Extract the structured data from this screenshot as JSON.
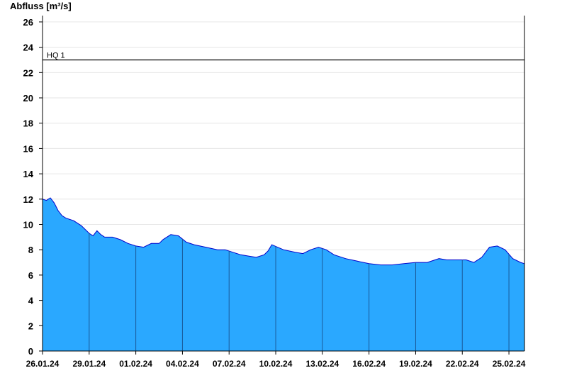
{
  "chart_data": {
    "type": "area",
    "ylabel": "Abfluss [m³/s]",
    "xlabel": "",
    "title": "",
    "ylim": [
      0,
      26.5
    ],
    "xlim": [
      "2024-01-26",
      "2024-02-26"
    ],
    "yticks": [
      0,
      2,
      4,
      6,
      8,
      10,
      12,
      14,
      16,
      18,
      20,
      22,
      24,
      26
    ],
    "xticks": [
      "26.01.24",
      "29.01.24",
      "01.02.24",
      "04.02.24",
      "07.02.24",
      "10.02.24",
      "13.02.24",
      "16.02.24",
      "19.02.24",
      "22.02.24",
      "25.02.24"
    ],
    "grid": true,
    "fill_color": "#2aa8ff",
    "line_color": "#0000cc",
    "reference_lines": [
      {
        "label": "HQ 1",
        "value": 23,
        "color": "#000000"
      }
    ],
    "series": [
      {
        "x": [
          "2024-01-26 00:00",
          "2024-01-26 06:00",
          "2024-01-26 12:00",
          "2024-01-26 18:00",
          "2024-01-27 00:00",
          "2024-01-27 06:00",
          "2024-01-27 12:00",
          "2024-01-28 00:00",
          "2024-01-28 12:00",
          "2024-01-29 00:00",
          "2024-01-29 06:00",
          "2024-01-29 12:00",
          "2024-01-29 18:00",
          "2024-01-30 00:00",
          "2024-01-30 12:00",
          "2024-01-31 00:00",
          "2024-01-31 12:00",
          "2024-02-01 00:00",
          "2024-02-01 12:00",
          "2024-02-02 00:00",
          "2024-02-02 12:00",
          "2024-02-02 18:00",
          "2024-02-03 06:00",
          "2024-02-03 18:00",
          "2024-02-04 06:00",
          "2024-02-04 18:00",
          "2024-02-05 12:00",
          "2024-02-06 06:00",
          "2024-02-06 18:00",
          "2024-02-07 06:00",
          "2024-02-07 18:00",
          "2024-02-08 06:00",
          "2024-02-08 18:00",
          "2024-02-09 06:00",
          "2024-02-09 12:00",
          "2024-02-09 18:00",
          "2024-02-10 12:00",
          "2024-02-11 06:00",
          "2024-02-11 18:00",
          "2024-02-12 06:00",
          "2024-02-12 18:00",
          "2024-02-13 06:00",
          "2024-02-13 18:00",
          "2024-02-14 12:00",
          "2024-02-15 06:00",
          "2024-02-16 00:00",
          "2024-02-16 18:00",
          "2024-02-17 12:00",
          "2024-02-18 06:00",
          "2024-02-19 00:00",
          "2024-02-19 18:00",
          "2024-02-20 12:00",
          "2024-02-21 00:00",
          "2024-02-21 18:00",
          "2024-02-22 06:00",
          "2024-02-22 18:00",
          "2024-02-23 06:00",
          "2024-02-23 18:00",
          "2024-02-24 06:00",
          "2024-02-24 18:00",
          "2024-02-25 06:00",
          "2024-02-25 18:00",
          "2024-02-26 00:00"
        ],
        "values": [
          12.0,
          11.9,
          12.1,
          11.7,
          11.1,
          10.7,
          10.5,
          10.3,
          9.9,
          9.3,
          9.1,
          9.5,
          9.2,
          9.0,
          9.0,
          8.8,
          8.5,
          8.3,
          8.2,
          8.5,
          8.5,
          8.8,
          9.2,
          9.1,
          8.6,
          8.4,
          8.2,
          8.0,
          8.0,
          7.8,
          7.6,
          7.5,
          7.4,
          7.6,
          7.9,
          8.4,
          8.0,
          7.8,
          7.7,
          8.0,
          8.2,
          8.0,
          7.6,
          7.3,
          7.1,
          6.9,
          6.8,
          6.8,
          6.9,
          7.0,
          7.0,
          7.3,
          7.2,
          7.2,
          7.2,
          7.0,
          7.4,
          8.2,
          8.3,
          8.0,
          7.3,
          7.0,
          6.9
        ]
      }
    ]
  }
}
